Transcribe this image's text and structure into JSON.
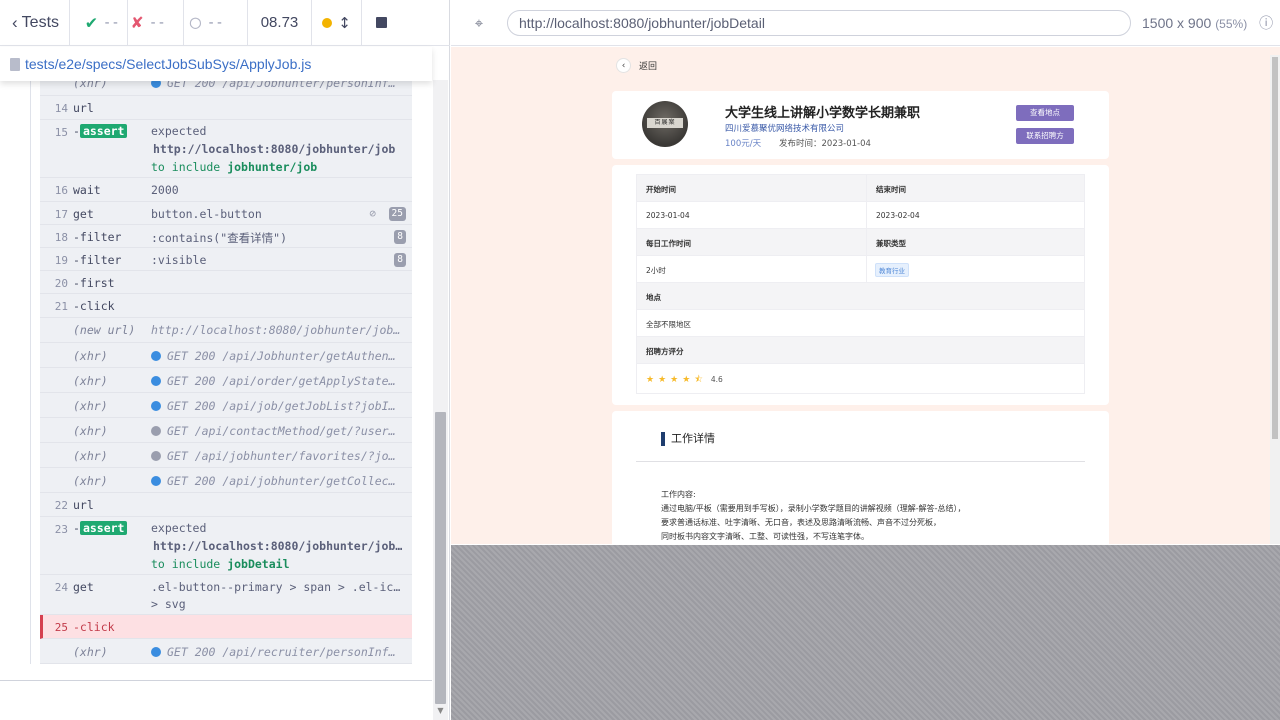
{
  "reporter": {
    "back_label": "Tests",
    "passed": "--",
    "failed": "--",
    "pending": "--",
    "duration": "08.73",
    "spec_path": "tests/e2e/specs/SelectJobSubSys/ApplyJob.js"
  },
  "commands": {
    "r0": {
      "name": "(xhr)",
      "msg": "GET 200 /api/Jobhunter/personInfo/..."
    },
    "r14": {
      "num": "14",
      "name": "url"
    },
    "r15": {
      "num": "15",
      "name": "-",
      "tag": "assert",
      "l1": "expected",
      "l2": "http://localhost:8080/jobhunter/job",
      "l3a": "to include",
      "l3b": "jobhunter/job"
    },
    "r16": {
      "num": "16",
      "name": "wait",
      "msg": "2000"
    },
    "r17": {
      "num": "17",
      "name": "get",
      "msg": "button.el-button",
      "badge": "25"
    },
    "r18": {
      "num": "18",
      "name": "-filter",
      "msg": ":contains(\"查看详情\")",
      "badge": "8"
    },
    "r19": {
      "num": "19",
      "name": "-filter",
      "msg": ":visible",
      "badge": "8"
    },
    "r20": {
      "num": "20",
      "name": "-first"
    },
    "r21": {
      "num": "21",
      "name": "-click"
    },
    "newurl": {
      "name": "(new url)",
      "msg": "http://localhost:8080/jobhunter/jobDe..."
    },
    "x1": {
      "name": "(xhr)",
      "msg": "GET 200 /api/Jobhunter/getAuthenti..."
    },
    "x2": {
      "name": "(xhr)",
      "msg": "GET 200 /api/order/getApplyState?j..."
    },
    "x3": {
      "name": "(xhr)",
      "msg": "GET 200 /api/job/getJobList?jobId=..."
    },
    "x4": {
      "name": "(xhr)",
      "msg": "GET /api/contactMethod/get/?userId..."
    },
    "x5": {
      "name": "(xhr)",
      "msg": "GET /api/jobhunter/favorites/?jobh..."
    },
    "x6": {
      "name": "(xhr)",
      "msg": "GET 200 /api/jobhunter/getCollectS..."
    },
    "r22": {
      "num": "22",
      "name": "url"
    },
    "r23": {
      "num": "23",
      "name": "-",
      "tag": "assert",
      "l1": "expected",
      "l2": "http://localhost:8080/jobhunter/jobDe...",
      "l3a": "to include",
      "l3b": "jobDetail"
    },
    "r24": {
      "num": "24",
      "name": "get",
      "msg1": ".el-button--primary > span > .el-icon",
      "msg2": "> svg"
    },
    "r25": {
      "num": "25",
      "name": "-click"
    },
    "x7": {
      "name": "(xhr)",
      "msg": "GET 200 /api/recruiter/personInfo/..."
    }
  },
  "aut": {
    "url": "http://localhost:8080/jobhunter/jobDetail",
    "viewport": "1500 x 900",
    "scale": "(55%)"
  },
  "page": {
    "back_label": "返回",
    "avatar_text": "百展案",
    "job_title": "大学生线上讲解小学数学长期兼职",
    "company": "四川爱慕聚优网络技术有限公司",
    "salary": "100元/天",
    "publish": "发布时间：2023-01-04",
    "btn_location": "查看地点",
    "btn_contact": "联系招聘方",
    "table": {
      "start_label": "开始时间",
      "end_label": "结束时间",
      "start_val": "2023-01-04",
      "end_val": "2023-02-04",
      "daily_label": "每日工作时间",
      "type_label": "兼职类型",
      "daily_val": "2小时",
      "type_val": "教育行业",
      "place_label": "地点",
      "place_val": "全部不限地区",
      "rating_label": "招聘方评分",
      "rating_val": "4.6"
    },
    "detail_heading": "工作详情",
    "detail_lines": [
      "工作内容:",
      "通过电脑/平板（需要用到手写板），录制小学数学题目的讲解视频（理解-解答-总结），",
      "要求普通话标准、吐字清晰、无口音，表述及思路清晰流畅、声音不过分死板，",
      "同时板书内容文字清晰、工整、可读性强，不写连笔字体。"
    ]
  },
  "rating": 4.6,
  "colors": {
    "pass": "#1fa971",
    "fail": "#e45770",
    "accent_btn": "#7e6dbd",
    "link": "#3b6fc6"
  }
}
